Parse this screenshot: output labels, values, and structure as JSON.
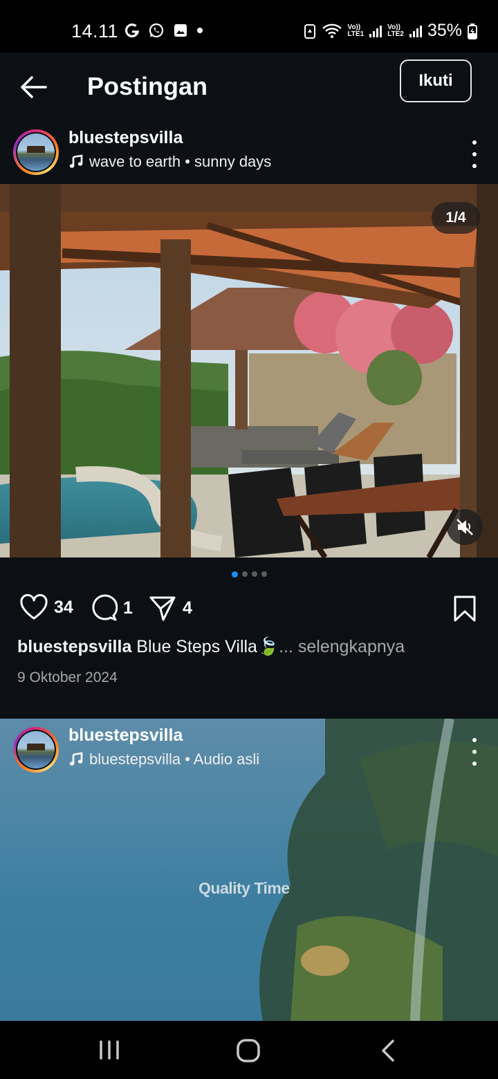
{
  "status_bar": {
    "time": "14.11",
    "left_icons": [
      "google-icon",
      "whatsapp-icon",
      "gallery-icon",
      "dot-icon"
    ],
    "battery": "35%",
    "sim1_label_top": "Vo))",
    "sim1_label_bottom": "LTE1",
    "sim2_label_top": "Vo))",
    "sim2_label_bottom": "LTE2"
  },
  "header": {
    "title": "Postingan",
    "follow_label": "Ikuti"
  },
  "post1": {
    "username": "bluestepsvilla",
    "audio": "wave to earth • sunny days",
    "counter": "1/4",
    "carousel_total": 4,
    "carousel_active": 1,
    "likes": "34",
    "comments": "1",
    "shares": "4",
    "caption_user": "bluestepsvilla",
    "caption_text": " Blue Steps Villa🍃",
    "caption_more": "... selengkapnya",
    "date": "9 Oktober 2024"
  },
  "post2": {
    "username": "bluestepsvilla",
    "audio": "bluestepsvilla • Audio asli",
    "overlay_text": "Quality Time"
  },
  "colors": {
    "background": "#0c1014",
    "accent_blue": "#1a8cff",
    "muted_text": "#a8a8a8"
  }
}
